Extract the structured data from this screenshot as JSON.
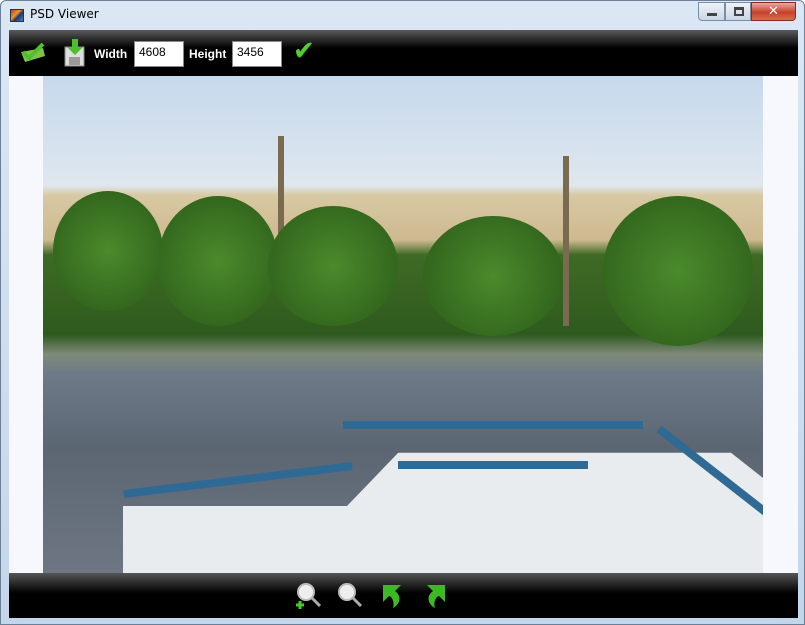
{
  "window": {
    "title": "PSD Viewer",
    "icon": "psd-viewer-app-icon",
    "controls": [
      "minimize",
      "maximize",
      "close"
    ],
    "close_glyph": "✕"
  },
  "toolbar": {
    "open_icon": "folder-check-icon",
    "save_icon": "save-download-icon",
    "width_label": "Width",
    "width_value": "4608",
    "height_label": "Height",
    "height_value": "3456",
    "apply_icon": "check-icon",
    "apply_glyph": "✔"
  },
  "bottombar": {
    "buttons": [
      "zoom-in-icon",
      "zoom-out-icon",
      "rotate-left-icon",
      "rotate-right-icon"
    ]
  },
  "colors": {
    "toolbar": "#000000",
    "accent_green": "#55cc33",
    "close_red": "#c7412c"
  }
}
